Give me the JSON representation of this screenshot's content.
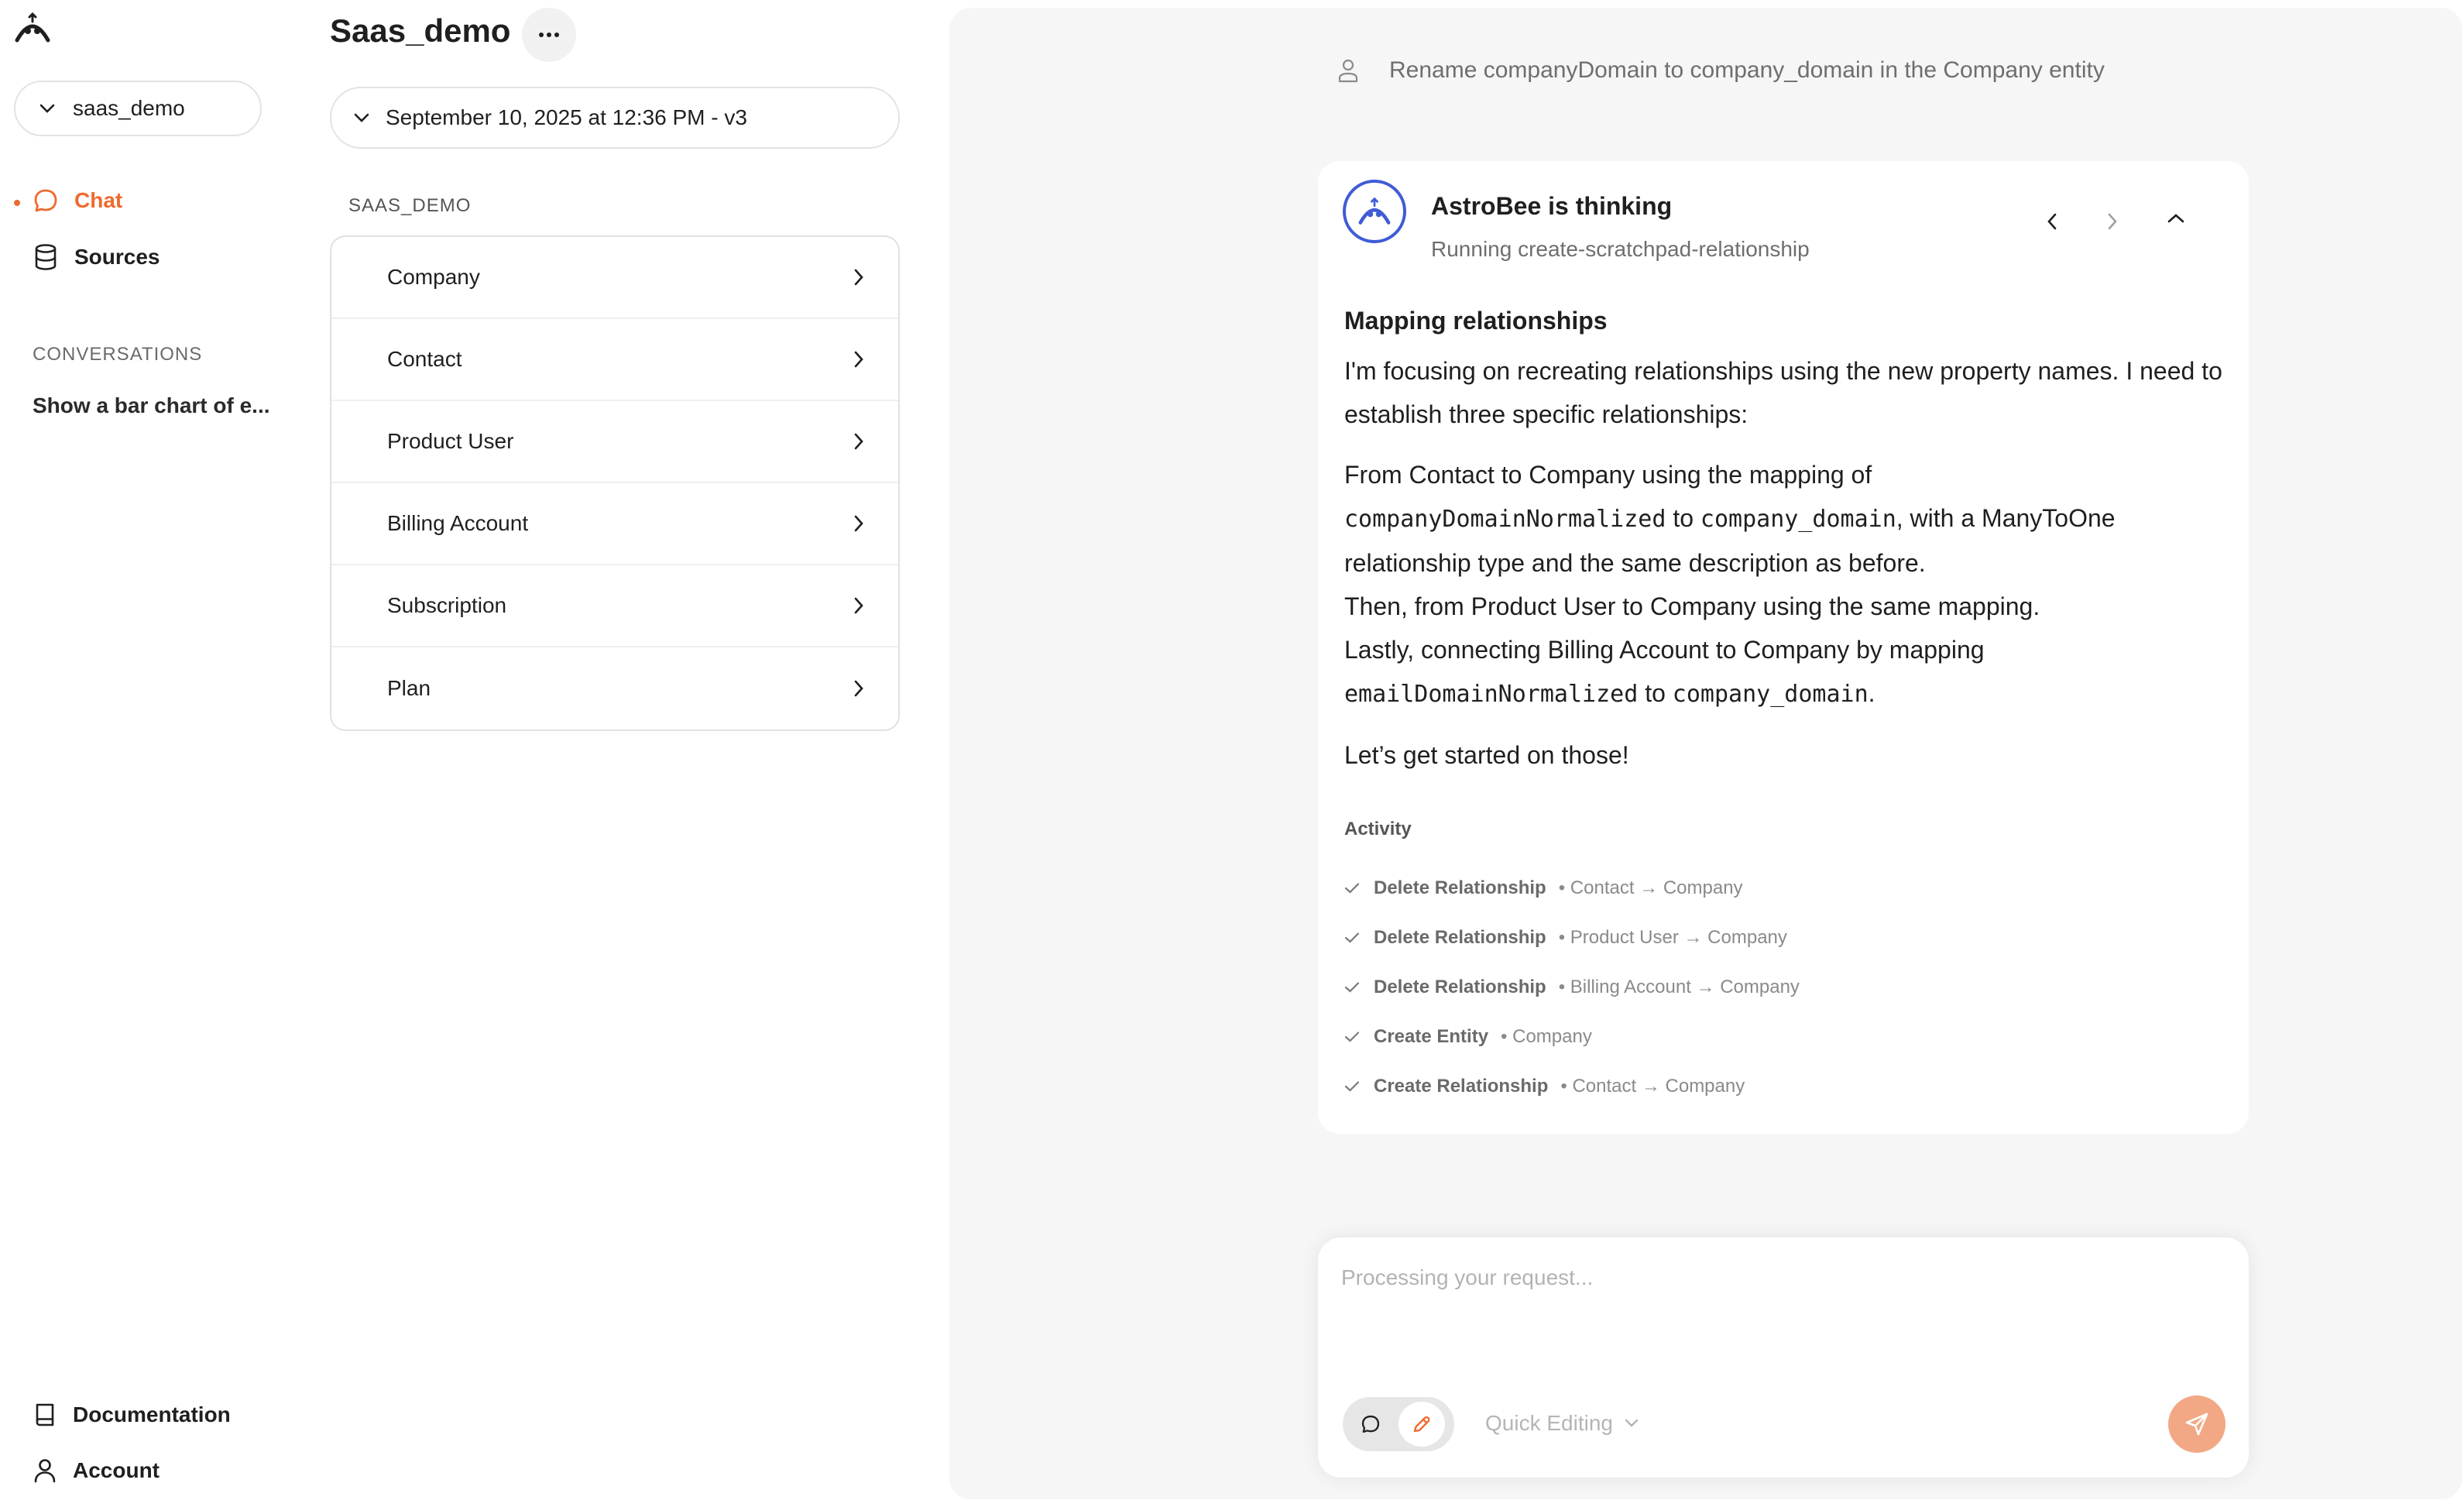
{
  "sidebar": {
    "project_selector": "saas_demo",
    "nav": {
      "chat": "Chat",
      "sources": "Sources"
    },
    "conversations_label": "CONVERSATIONS",
    "conversations": [
      "Show a bar chart of e..."
    ],
    "footer": {
      "documentation": "Documentation",
      "account": "Account"
    }
  },
  "schema_panel": {
    "title": "Saas_demo",
    "version": "September 10, 2025 at 12:36 PM - v3",
    "schema_label": "SAAS_DEMO",
    "entities": [
      "Company",
      "Contact",
      "Product User",
      "Billing Account",
      "Subscription",
      "Plan"
    ]
  },
  "chat": {
    "user_message": "Rename companyDomain to company_domain in the Company entity",
    "thinking": {
      "title": "AstroBee is thinking",
      "subtitle": "Running create-scratchpad-relationship",
      "heading": "Mapping relationships",
      "paragraph1": "I'm focusing on recreating relationships using the new property names. I need to establish three specific relationships:",
      "paragraph2": {
        "t1": "From Contact to Company using the mapping of",
        "c1": "companyDomainNormalized",
        "t2": "to",
        "c2": "company_domain",
        "t3": ", with a ManyToOne relationship type and the same description as before.",
        "line2": "Then, from Product User to Company using the same mapping.",
        "t4": "Lastly, connecting Billing Account to Company by mapping",
        "c3": "emailDomainNormalized",
        "t5": "to",
        "c4": "company_domain",
        "t6": "."
      },
      "paragraph3": "Let’s get started on those!",
      "activity_label": "Activity",
      "activity": [
        {
          "name": "Delete Relationship",
          "detail": "• Contact → Company"
        },
        {
          "name": "Delete Relationship",
          "detail": "• Product User → Company"
        },
        {
          "name": "Delete Relationship",
          "detail": "• Billing Account → Company"
        },
        {
          "name": "Create Entity",
          "detail": "• Company"
        },
        {
          "name": "Create Relationship",
          "detail": "• Contact → Company"
        }
      ]
    },
    "composer": {
      "placeholder": "Processing your request...",
      "mode_label": "Quick Editing"
    }
  },
  "colors": {
    "accent": "#ee6b2f",
    "send_button": "#f2a885",
    "avatar_ring": "#3f5bd6",
    "chat_background": "#f6f6f6"
  }
}
